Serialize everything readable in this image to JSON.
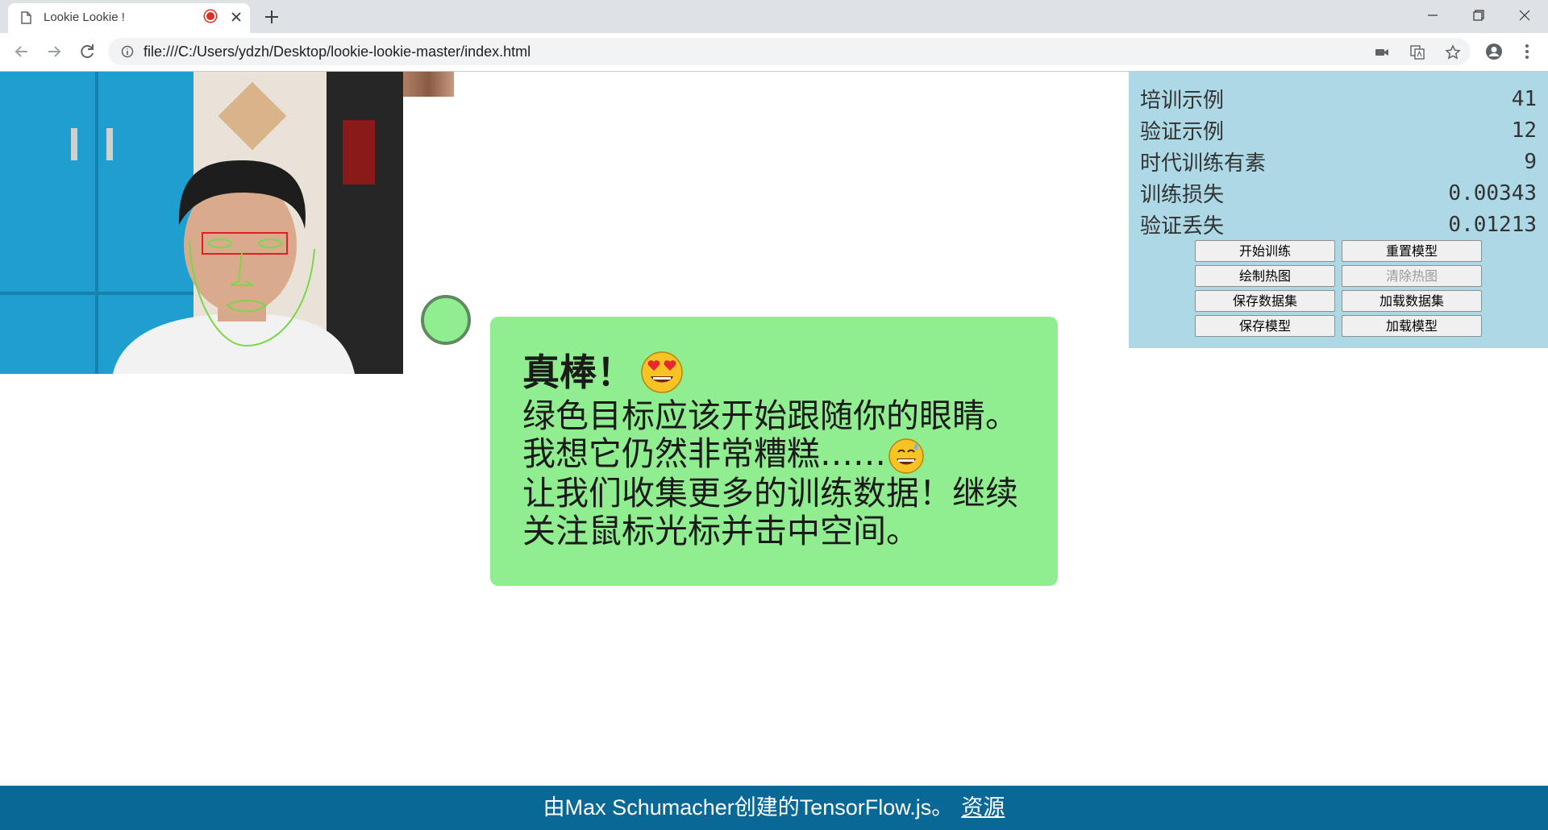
{
  "browser": {
    "tab_title": "Lookie Lookie !",
    "url": "file:///C:/Users/ydzh/Desktop/lookie-lookie-master/index.html",
    "recording_color": "#d93025"
  },
  "stats": {
    "rows": [
      {
        "label": "培训示例",
        "value": "41"
      },
      {
        "label": "验证示例",
        "value": "12"
      },
      {
        "label": "时代训练有素",
        "value": "9"
      },
      {
        "label": "训练损失",
        "value": "0.00343"
      },
      {
        "label": "验证丢失",
        "value": "0.01213"
      }
    ],
    "panel_color": "#add8e6"
  },
  "buttons": {
    "start_training": "开始训练",
    "reset_model": "重置模型",
    "draw_heatmap": "绘制热图",
    "clear_heatmap": "清除热图",
    "save_dataset": "保存数据集",
    "load_dataset": "加载数据集",
    "save_model": "保存模型",
    "load_model": "加载模型"
  },
  "message": {
    "heading": "真棒！",
    "heading_emoji": "heart-eyes-emoji",
    "line1": "绿色目标应该开始跟随你的眼睛。",
    "line2": "我想它仍然非常糟糕……",
    "line2_emoji": "sweat-smile-emoji",
    "line3": "让我们收集更多的训练数据！继续关注鼠标光标并击中空间。",
    "background": "#90ee90"
  },
  "footer": {
    "text": "由Max Schumacher创建的TensorFlow.js。",
    "link": "资源",
    "background": "#0a6896"
  }
}
